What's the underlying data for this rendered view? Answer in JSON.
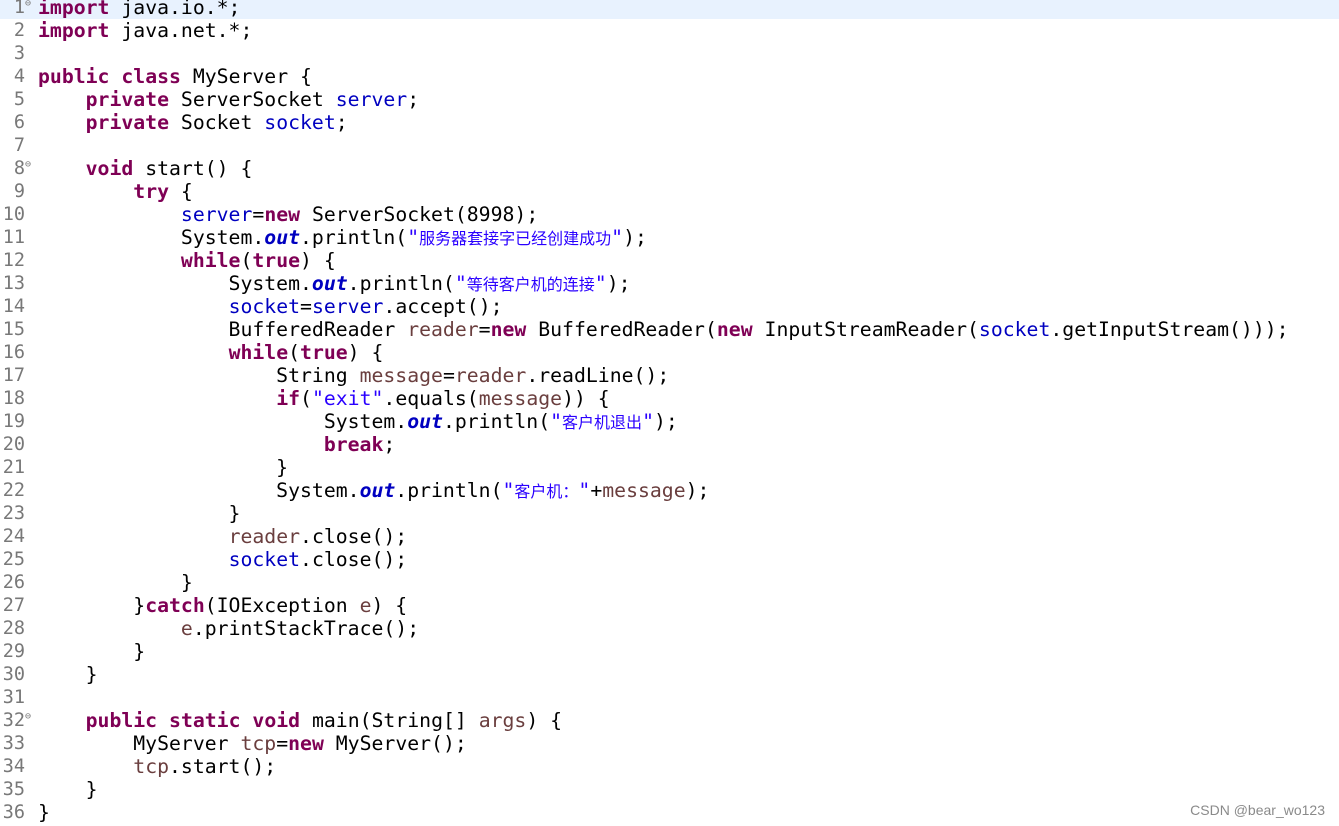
{
  "editor": {
    "lines": [
      {
        "n": "1",
        "current": true,
        "fold": true,
        "tokens": [
          [
            "kw",
            "import"
          ],
          [
            "",
            "·java.io.*;"
          ]
        ]
      },
      {
        "n": "2",
        "tokens": [
          [
            "kw",
            "import"
          ],
          [
            "",
            "·java.net.*;"
          ]
        ]
      },
      {
        "n": "3",
        "tokens": []
      },
      {
        "n": "4",
        "tokens": [
          [
            "kw",
            "public"
          ],
          [
            "",
            "·"
          ],
          [
            "kw",
            "class"
          ],
          [
            "",
            "·MyServer·{"
          ]
        ]
      },
      {
        "n": "5",
        "tokens": [
          [
            "",
            "····"
          ],
          [
            "kw",
            "private"
          ],
          [
            "",
            "·ServerSocket·"
          ],
          [
            "fld",
            "server"
          ],
          [
            "",
            ";"
          ]
        ]
      },
      {
        "n": "6",
        "tokens": [
          [
            "",
            "····"
          ],
          [
            "kw",
            "private"
          ],
          [
            "",
            "·Socket·"
          ],
          [
            "fld",
            "socket"
          ],
          [
            "",
            ";"
          ]
        ]
      },
      {
        "n": "7",
        "tokens": []
      },
      {
        "n": "8",
        "fold": true,
        "tokens": [
          [
            "",
            "····"
          ],
          [
            "kw",
            "void"
          ],
          [
            "",
            "·start()·{"
          ]
        ]
      },
      {
        "n": "9",
        "tokens": [
          [
            "",
            "········"
          ],
          [
            "kw",
            "try"
          ],
          [
            "",
            "·{"
          ]
        ]
      },
      {
        "n": "10",
        "tokens": [
          [
            "",
            "············"
          ],
          [
            "fld",
            "server"
          ],
          [
            "",
            "="
          ],
          [
            "kw",
            "new"
          ],
          [
            "",
            "·ServerSocket(8998);"
          ]
        ]
      },
      {
        "n": "11",
        "tokens": [
          [
            "",
            "············System."
          ],
          [
            "sfld",
            "out"
          ],
          [
            "",
            ".println("
          ],
          [
            "str",
            "\""
          ],
          [
            "str cjk",
            "服务器套接字已经创建成功"
          ],
          [
            "str",
            "\""
          ],
          [
            "",
            ");"
          ]
        ]
      },
      {
        "n": "12",
        "tokens": [
          [
            "",
            "············"
          ],
          [
            "kw",
            "while"
          ],
          [
            "",
            "("
          ],
          [
            "kw",
            "true"
          ],
          [
            "",
            ")·{"
          ]
        ]
      },
      {
        "n": "13",
        "tokens": [
          [
            "",
            "················System."
          ],
          [
            "sfld",
            "out"
          ],
          [
            "",
            ".println("
          ],
          [
            "str",
            "\""
          ],
          [
            "str cjk",
            "等待客户机的连接"
          ],
          [
            "str",
            "\""
          ],
          [
            "",
            ");"
          ]
        ]
      },
      {
        "n": "14",
        "tokens": [
          [
            "",
            "················"
          ],
          [
            "fld",
            "socket"
          ],
          [
            "",
            "="
          ],
          [
            "fld",
            "server"
          ],
          [
            "",
            ".accept();"
          ]
        ]
      },
      {
        "n": "15",
        "tokens": [
          [
            "",
            "················BufferedReader·"
          ],
          [
            "var",
            "reader"
          ],
          [
            "",
            "="
          ],
          [
            "kw",
            "new"
          ],
          [
            "",
            "·BufferedReader("
          ],
          [
            "kw",
            "new"
          ],
          [
            "",
            "·InputStreamReader("
          ],
          [
            "fld",
            "socket"
          ],
          [
            "",
            ".getInputStream()));"
          ]
        ]
      },
      {
        "n": "16",
        "tokens": [
          [
            "",
            "················"
          ],
          [
            "kw",
            "while"
          ],
          [
            "",
            "("
          ],
          [
            "kw",
            "true"
          ],
          [
            "",
            ")·{"
          ]
        ]
      },
      {
        "n": "17",
        "tokens": [
          [
            "",
            "····················String·"
          ],
          [
            "var",
            "message"
          ],
          [
            "",
            "="
          ],
          [
            "var",
            "reader"
          ],
          [
            "",
            ".readLine();"
          ]
        ]
      },
      {
        "n": "18",
        "tokens": [
          [
            "",
            "····················"
          ],
          [
            "kw",
            "if"
          ],
          [
            "",
            "("
          ],
          [
            "str",
            "\"exit\""
          ],
          [
            "",
            ".equals("
          ],
          [
            "var",
            "message"
          ],
          [
            "",
            "))·{"
          ]
        ]
      },
      {
        "n": "19",
        "tokens": [
          [
            "",
            "························System."
          ],
          [
            "sfld",
            "out"
          ],
          [
            "",
            ".println("
          ],
          [
            "str",
            "\""
          ],
          [
            "str cjk",
            "客户机退出"
          ],
          [
            "str",
            "\""
          ],
          [
            "",
            ");"
          ]
        ]
      },
      {
        "n": "20",
        "tokens": [
          [
            "",
            "························"
          ],
          [
            "kw",
            "break"
          ],
          [
            "",
            ";"
          ]
        ]
      },
      {
        "n": "21",
        "tokens": [
          [
            "",
            "····················}"
          ]
        ]
      },
      {
        "n": "22",
        "tokens": [
          [
            "",
            "····················System."
          ],
          [
            "sfld",
            "out"
          ],
          [
            "",
            ".println("
          ],
          [
            "str",
            "\""
          ],
          [
            "str cjk",
            "客户机："
          ],
          [
            "str",
            "\""
          ],
          [
            "",
            "+"
          ],
          [
            "var",
            "message"
          ],
          [
            "",
            ");"
          ]
        ]
      },
      {
        "n": "23",
        "tokens": [
          [
            "",
            "················}"
          ]
        ]
      },
      {
        "n": "24",
        "tokens": [
          [
            "",
            "················"
          ],
          [
            "var",
            "reader"
          ],
          [
            "",
            ".close();"
          ]
        ]
      },
      {
        "n": "25",
        "tokens": [
          [
            "",
            "················"
          ],
          [
            "fld",
            "socket"
          ],
          [
            "",
            ".close();"
          ]
        ]
      },
      {
        "n": "26",
        "tokens": [
          [
            "",
            "············}"
          ]
        ]
      },
      {
        "n": "27",
        "tokens": [
          [
            "",
            "········}"
          ],
          [
            "kw",
            "catch"
          ],
          [
            "",
            "(IOException·"
          ],
          [
            "var",
            "e"
          ],
          [
            "",
            ")·{"
          ]
        ]
      },
      {
        "n": "28",
        "tokens": [
          [
            "",
            "············"
          ],
          [
            "var",
            "e"
          ],
          [
            "",
            ".printStackTrace();"
          ]
        ]
      },
      {
        "n": "29",
        "tokens": [
          [
            "",
            "········}"
          ]
        ]
      },
      {
        "n": "30",
        "tokens": [
          [
            "",
            "····}"
          ]
        ]
      },
      {
        "n": "31",
        "tokens": []
      },
      {
        "n": "32",
        "fold": true,
        "tokens": [
          [
            "",
            "····"
          ],
          [
            "kw",
            "public"
          ],
          [
            "",
            "·"
          ],
          [
            "kw",
            "static"
          ],
          [
            "",
            "·"
          ],
          [
            "kw",
            "void"
          ],
          [
            "",
            "·main(String[]·"
          ],
          [
            "var",
            "args"
          ],
          [
            "",
            ")·{"
          ]
        ]
      },
      {
        "n": "33",
        "tokens": [
          [
            "",
            "········MyServer·"
          ],
          [
            "var",
            "tcp"
          ],
          [
            "",
            "="
          ],
          [
            "kw",
            "new"
          ],
          [
            "",
            "·MyServer();"
          ]
        ]
      },
      {
        "n": "34",
        "tokens": [
          [
            "",
            "········"
          ],
          [
            "var",
            "tcp"
          ],
          [
            "",
            ".start();"
          ]
        ]
      },
      {
        "n": "35",
        "tokens": [
          [
            "",
            "····}"
          ]
        ]
      },
      {
        "n": "36",
        "tokens": [
          [
            "",
            "}"
          ]
        ]
      }
    ]
  },
  "watermark": "CSDN @bear_wo123",
  "icons": {
    "fold": "fold-minus-icon"
  }
}
